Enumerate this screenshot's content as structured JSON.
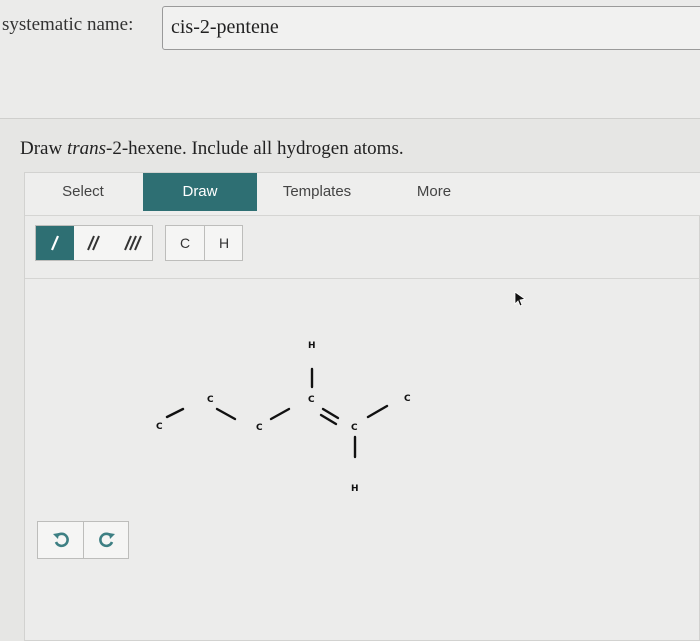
{
  "systematic": {
    "label": "systematic name:",
    "value": "cis-2-pentene"
  },
  "question": {
    "prefix": "Draw ",
    "italic": "trans",
    "suffix": "-2-hexene. Include all hydrogen atoms."
  },
  "tabs": [
    {
      "label": "Select"
    },
    {
      "label": "Draw"
    },
    {
      "label": "Templates"
    },
    {
      "label": "More"
    }
  ],
  "active_tab": "Draw",
  "atom_buttons": [
    {
      "label": "C"
    },
    {
      "label": "H"
    }
  ],
  "molecule": {
    "atoms": [
      "C",
      "C",
      "C",
      "C",
      "C",
      "C",
      "H",
      "H"
    ]
  },
  "colors": {
    "accent": "#2e6f73",
    "undo_icon": "#3d7f83"
  }
}
